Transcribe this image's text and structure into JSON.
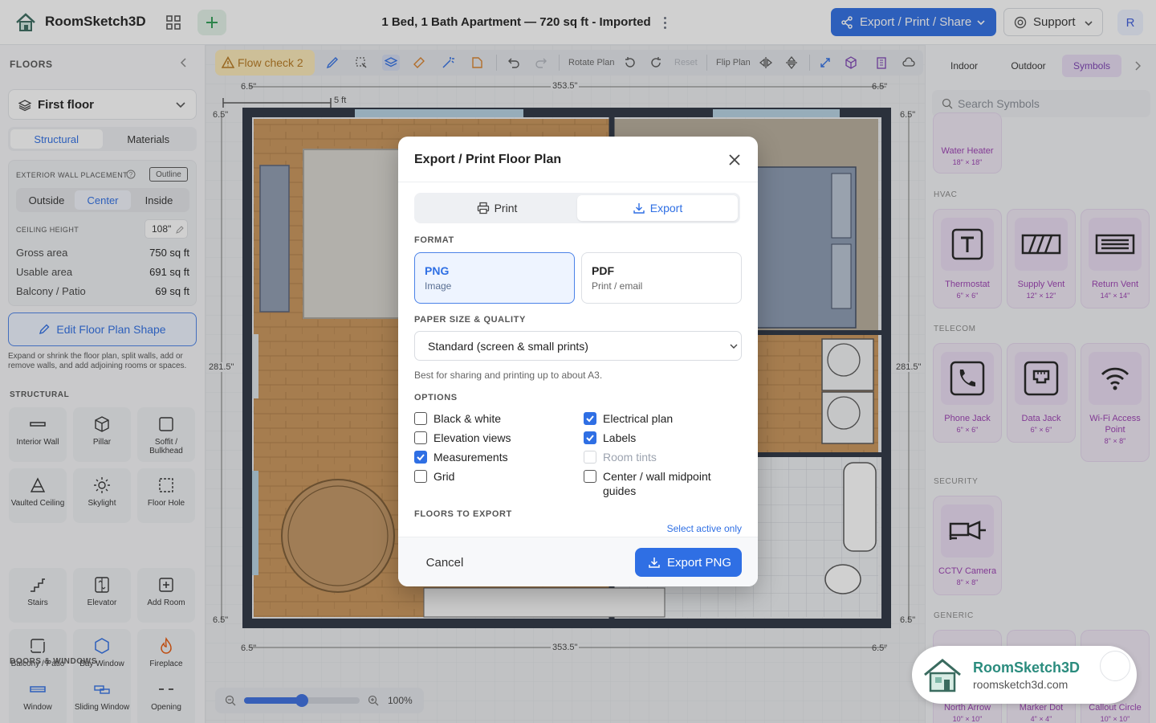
{
  "header": {
    "app_name": "RoomSketch3D",
    "title": "1 Bed, 1 Bath Apartment — 720 sq ft - Imported",
    "export_label": "Export / Print / Share",
    "support_label": "Support",
    "avatar_initial": "R"
  },
  "left": {
    "floors_heading": "FLOORS",
    "floor_select": "First floor",
    "tabs": [
      "Structural",
      "Materials"
    ],
    "wall_placement_label": "EXTERIOR WALL PLACEMENT",
    "outline_badge": "Outline",
    "placement_options": [
      "Outside",
      "Center",
      "Inside"
    ],
    "ceiling_label": "CEILING HEIGHT",
    "ceiling_value": "108\"",
    "stats": [
      {
        "label": "Gross area",
        "value": "750 sq ft"
      },
      {
        "label": "Usable area",
        "value": "691 sq ft"
      },
      {
        "label": "Balcony / Patio",
        "value": "69 sq ft"
      }
    ],
    "edit_button": "Edit Floor Plan Shape",
    "edit_hint": "Expand or shrink the floor plan, split walls, add or remove walls, and add adjoining rooms or spaces.",
    "structural_heading": "STRUCTURAL",
    "tools": [
      {
        "label": "Interior Wall",
        "icon": "wall-icon"
      },
      {
        "label": "Pillar",
        "icon": "cube-icon"
      },
      {
        "label": "Soffit / Bulkhead",
        "icon": "soffit-icon"
      },
      {
        "label": "Vaulted Ceiling",
        "icon": "vaulted-icon"
      },
      {
        "label": "Skylight",
        "icon": "sun-icon"
      },
      {
        "label": "Floor Hole",
        "icon": "dashed-square-icon"
      },
      {
        "label": "Stairs",
        "icon": "stairs-icon"
      },
      {
        "label": "Elevator",
        "icon": "elevator-icon"
      },
      {
        "label": "Add Room",
        "icon": "plus-square-icon"
      },
      {
        "label": "Balcony / Patio",
        "icon": "balcony-icon"
      },
      {
        "label": "Bay Window",
        "icon": "hexagon-icon"
      },
      {
        "label": "Fireplace",
        "icon": "flame-icon"
      }
    ],
    "doors_heading": "DOORS & WINDOWS",
    "door_tools": [
      {
        "label": "Window",
        "icon": "window-icon"
      },
      {
        "label": "Sliding Window",
        "icon": "sliding-window-icon"
      },
      {
        "label": "Opening",
        "icon": "opening-icon"
      }
    ]
  },
  "toolbar": {
    "flow_check": "Flow check 2",
    "rotate_label": "Rotate Plan",
    "reset_label": "Reset",
    "flip_label": "Flip Plan"
  },
  "canvas": {
    "scale_label": "5 ft",
    "dim_top": "353.5\"",
    "dim_bottom": "353.5\"",
    "dim_left": "281.5\"",
    "dim_right": "281.5\"",
    "dim_small": "6.5\"",
    "zoom_value": "100%",
    "zoom_level": 0.5
  },
  "right": {
    "tabs": [
      "Indoor",
      "Outdoor",
      "Symbols"
    ],
    "search_placeholder": "Search Symbols",
    "top_symbol": {
      "name": "Water Heater",
      "dim": "18\" × 18\""
    },
    "hvac_heading": "HVAC",
    "hvac": [
      {
        "name": "Thermostat",
        "dim": "6\" × 6\""
      },
      {
        "name": "Supply Vent",
        "dim": "12\" × 12\""
      },
      {
        "name": "Return Vent",
        "dim": "14\" × 14\""
      }
    ],
    "telecom_heading": "TELECOM",
    "telecom": [
      {
        "name": "Phone Jack",
        "dim": "6\" × 6\""
      },
      {
        "name": "Data Jack",
        "dim": "6\" × 6\""
      },
      {
        "name": "Wi-Fi Access Point",
        "dim": "8\" × 8\""
      }
    ],
    "security_heading": "SECURITY",
    "security": [
      {
        "name": "CCTV Camera",
        "dim": "8\" × 8\""
      }
    ],
    "generic_heading": "GENERIC",
    "generic": [
      {
        "name": "North Arrow",
        "dim": "10\" × 10\""
      },
      {
        "name": "Marker Dot",
        "dim": "4\" × 4\""
      },
      {
        "name": "Callout Circle",
        "dim": "10\" × 10\""
      }
    ]
  },
  "modal": {
    "title": "Export / Print Floor Plan",
    "tabs": [
      "Print",
      "Export"
    ],
    "format_label": "FORMAT",
    "formats": [
      {
        "title": "PNG",
        "sub": "Image"
      },
      {
        "title": "PDF",
        "sub": "Print / email"
      }
    ],
    "paper_label": "PAPER SIZE & QUALITY",
    "paper_value": "Standard (screen & small prints)",
    "paper_hint": "Best for sharing and printing up to about A3.",
    "options_label": "OPTIONS",
    "options_left": [
      {
        "label": "Black & white",
        "checked": false
      },
      {
        "label": "Elevation views",
        "checked": false
      },
      {
        "label": "Measurements",
        "checked": true
      },
      {
        "label": "Grid",
        "checked": false
      }
    ],
    "options_right": [
      {
        "label": "Electrical plan",
        "checked": true
      },
      {
        "label": "Labels",
        "checked": true
      },
      {
        "label": "Room tints",
        "checked": false,
        "disabled": true
      },
      {
        "label": "Center / wall midpoint guides",
        "checked": false
      }
    ],
    "floors_label": "FLOORS TO EXPORT",
    "select_active": "Select active only",
    "cancel": "Cancel",
    "export_png": "Export PNG"
  },
  "badge": {
    "name": "RoomSketch3D",
    "url": "roomsketch3d.com"
  }
}
